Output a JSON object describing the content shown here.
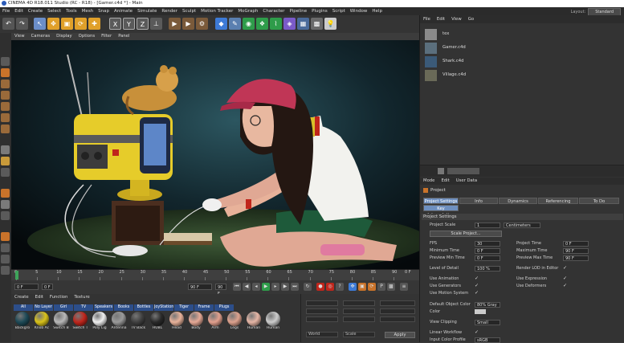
{
  "window": {
    "title": "CINEMA 4D R18.011 Studio (RC - R18) - [Gamer.c4d *] - Main"
  },
  "menubar": {
    "items": [
      "File",
      "Edit",
      "Create",
      "Select",
      "Tools",
      "Mesh",
      "Snap",
      "Animate",
      "Simulate",
      "Render",
      "Sculpt",
      "Motion Tracker",
      "MoGraph",
      "Character",
      "Pipeline",
      "Plugins",
      "Script",
      "Window",
      "Help"
    ],
    "layout_label": "Layout:",
    "layout_value": "Standard"
  },
  "toolbar": {
    "icons": [
      "undo-icon",
      "redo-icon",
      "live-select-icon",
      "move-icon",
      "scale-icon",
      "rotate-icon",
      "axis-x-icon",
      "axis-y-icon",
      "axis-z-icon",
      "coordinate-system-icon",
      "render-view-icon",
      "render-picture-queue-icon",
      "edit-render-settings-icon",
      "cube-icon",
      "pen-spline-icon",
      "subdivision-icon",
      "array-icon",
      "deformer-icon",
      "scene-floor-icon",
      "camera-icon",
      "light-icon"
    ]
  },
  "viewport_menu": {
    "items": [
      "View",
      "Cameras",
      "Display",
      "Options",
      "Filter",
      "Panel"
    ]
  },
  "timeline": {
    "ticks": [
      "0",
      "5",
      "10",
      "15",
      "20",
      "25",
      "30",
      "35",
      "40",
      "45",
      "50",
      "55",
      "60",
      "65",
      "70",
      "75",
      "80",
      "85",
      "90"
    ],
    "end_label": "0 F"
  },
  "transport": {
    "start": "0 F",
    "current": "0 F",
    "end": "90 F",
    "end2": "90 F"
  },
  "material_panel": {
    "menu": [
      "Create",
      "Edit",
      "Function",
      "Texture"
    ],
    "tabs": [
      "All",
      "No Layer",
      "Girl",
      "TV",
      "Speakers",
      "Books",
      "Bottles",
      "JoyStation",
      "Tiger",
      "Frame",
      "Plugs"
    ],
    "materials": [
      {
        "name": "Backgro",
        "color": "#1e4a57"
      },
      {
        "name": "Knob Ac",
        "color": "#d9c21a"
      },
      {
        "name": "Switch B",
        "color": "#b8b8b8"
      },
      {
        "name": "Switch T",
        "color": "#c0261c"
      },
      {
        "name": "Poly Lig",
        "color": "#f0f0f0"
      },
      {
        "name": "Antenna",
        "color": "#9a9a9a"
      },
      {
        "name": "TV Back",
        "color": "#404040"
      },
      {
        "name": "HUBL",
        "color": "#2a2a2a"
      },
      {
        "name": "Head",
        "color": "#e8b29a"
      },
      {
        "name": "Body",
        "color": "#e6a996"
      },
      {
        "name": "Arm",
        "color": "#e2a08e"
      },
      {
        "name": "Legs",
        "color": "#dda28e"
      },
      {
        "name": "Human",
        "color": "#e6b6a6"
      },
      {
        "name": "Human",
        "color": "#cccccc"
      }
    ]
  },
  "coordinates": {
    "apply_label": "Apply",
    "dropdown1": "World",
    "dropdown2": "Scale"
  },
  "object_manager": {
    "menu": [
      "File",
      "Edit",
      "View",
      "Go"
    ],
    "objects": [
      {
        "name": "tex",
        "thumb": "#8a8a8a"
      },
      {
        "name": "Gamer.c4d",
        "thumb": "#5b6f7d"
      },
      {
        "name": "Shark.c4d",
        "thumb": "#3b5a78"
      },
      {
        "name": "Village.c4d",
        "thumb": "#6a6a58"
      }
    ]
  },
  "attributes": {
    "menu": [
      "Mode",
      "Edit",
      "User Data"
    ],
    "title": "Project",
    "tabs": [
      "Project Settings",
      "Info",
      "Dynamics",
      "Referencing",
      "To Do",
      "Key Interpolation"
    ],
    "section_title": "Project Settings",
    "project_scale_label": "Project Scale",
    "project_scale_value": "1",
    "project_scale_unit": "Centimeters",
    "scale_project_button": "Scale Project...",
    "fps_label": "FPS",
    "fps_value": "30",
    "project_time_label": "Project Time",
    "project_time_value": "0 F",
    "min_time_label": "Minimum Time",
    "min_time_value": "0 F",
    "max_time_label": "Maximum Time",
    "max_time_value": "90 F",
    "preview_min_label": "Preview Min Time",
    "preview_min_value": "0 F",
    "preview_max_label": "Preview Max Time",
    "preview_max_value": "90 F",
    "lod_label": "Level of Detail",
    "lod_value": "100 %",
    "render_lod_label": "Render LOD in Editor",
    "use_animation_label": "Use Animation",
    "use_expression_label": "Use Expression",
    "use_generators_label": "Use Generators",
    "use_deformers_label": "Use Deformers",
    "use_motion_label": "Use Motion System",
    "default_color_label": "Default Object Color",
    "default_color_value": "80% Gray",
    "color_label": "Color",
    "view_clipping_label": "View Clipping",
    "view_clipping_value": "Small",
    "linear_workflow_label": "Linear Workflow",
    "input_color_label": "Input Color Profile",
    "input_color_value": "sRGB"
  }
}
